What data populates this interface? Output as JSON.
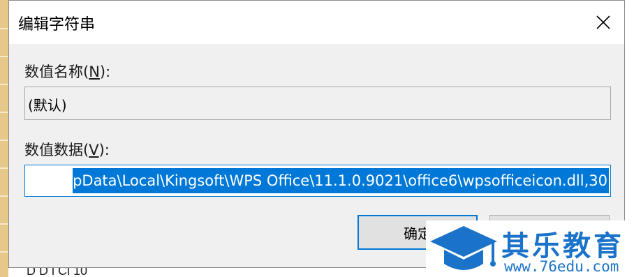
{
  "dialog": {
    "title": "编辑字符串",
    "value_name_label": "数值名称(",
    "value_name_hotkey": "N",
    "value_name_suffix": "):",
    "value_name": "(默认)",
    "value_data_label": "数值数据(",
    "value_data_hotkey": "V",
    "value_data_suffix": "):",
    "value_data": "pData\\Local\\Kingsoft\\WPS Office\\11.1.0.9021\\office6\\wpsofficeicon.dll,30",
    "ok_label": "确定",
    "cancel_label": ""
  },
  "background": {
    "partial_text": "D    D  l  Cl    10"
  },
  "watermark": {
    "brand": "其乐教育",
    "url": "www.76edu.com",
    "color": "#1a73c9"
  },
  "colors": {
    "accent": "#0078d7",
    "dialog_bg": "#f0f0f0"
  }
}
